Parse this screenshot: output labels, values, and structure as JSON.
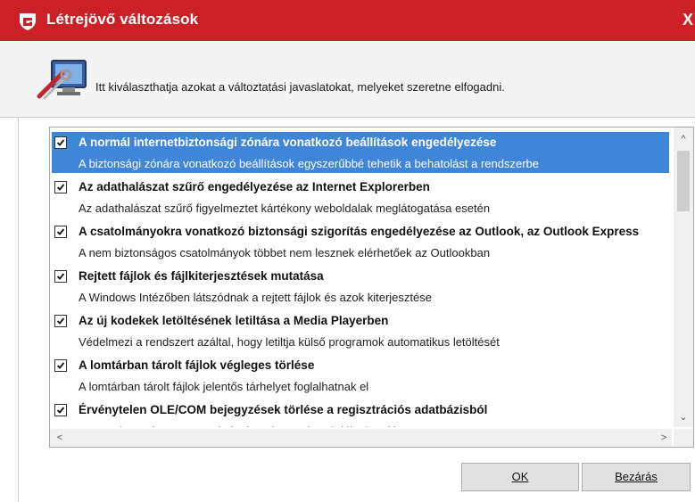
{
  "window": {
    "title": "Létrejövő változások",
    "close_label": "X",
    "accent_color": "#cc2027"
  },
  "header": {
    "icon": "tools-monitor-icon",
    "description": "Itt kiválaszthatja azokat a változtatási javaslatokat, melyeket szeretne elfogadni."
  },
  "list": {
    "items": [
      {
        "title": "A normál internetbiztonsági zónára vonatkozó beállítások engedélyezése",
        "description": "A biztonsági zónára vonatkozó beállítások egyszerűbbé tehetik a behatolást a rendszerbe",
        "checked": true,
        "selected": true
      },
      {
        "title": "Az adathalászat szűrő engedélyezése az Internet Explorerben",
        "description": "Az adathalászat szűrő figyelmeztet kártékony weboldalak meglátogatása esetén",
        "checked": true,
        "selected": false
      },
      {
        "title": "A csatolmányokra vonatkozó biztonsági szigorítás engedélyezése az Outlook, az Outlook Express",
        "description": "A nem biztonságos csatolmányok többet nem lesznek elérhetőek az Outlookban",
        "checked": true,
        "selected": false
      },
      {
        "title": "Rejtett fájlok és fájlkiterjesztések mutatása",
        "description": "A Windows Intézőben látszódnak a rejtett fájlok és azok kiterjesztése",
        "checked": true,
        "selected": false
      },
      {
        "title": "Az új kodekek letöltésének letiltása a Media Playerben",
        "description": "Védelmezi a rendszert azáltal, hogy letiltja külső programok automatikus letöltését",
        "checked": true,
        "selected": false
      },
      {
        "title": "A lomtárban tárolt fájlok végleges törlése",
        "description": "A lomtárban tárolt fájlok jelentős tárhelyet foglalhatnak el",
        "checked": true,
        "selected": false
      },
      {
        "title": "Érvénytelen OLE/COM bejegyzések törlése a regisztrációs adatbázisból",
        "description": "Az OLE/COM komponensek érvénytelen regisztrációinak törlése",
        "checked": true,
        "selected": false
      }
    ]
  },
  "buttons": {
    "ok_label": "OK",
    "close_label": "Bezárás"
  }
}
